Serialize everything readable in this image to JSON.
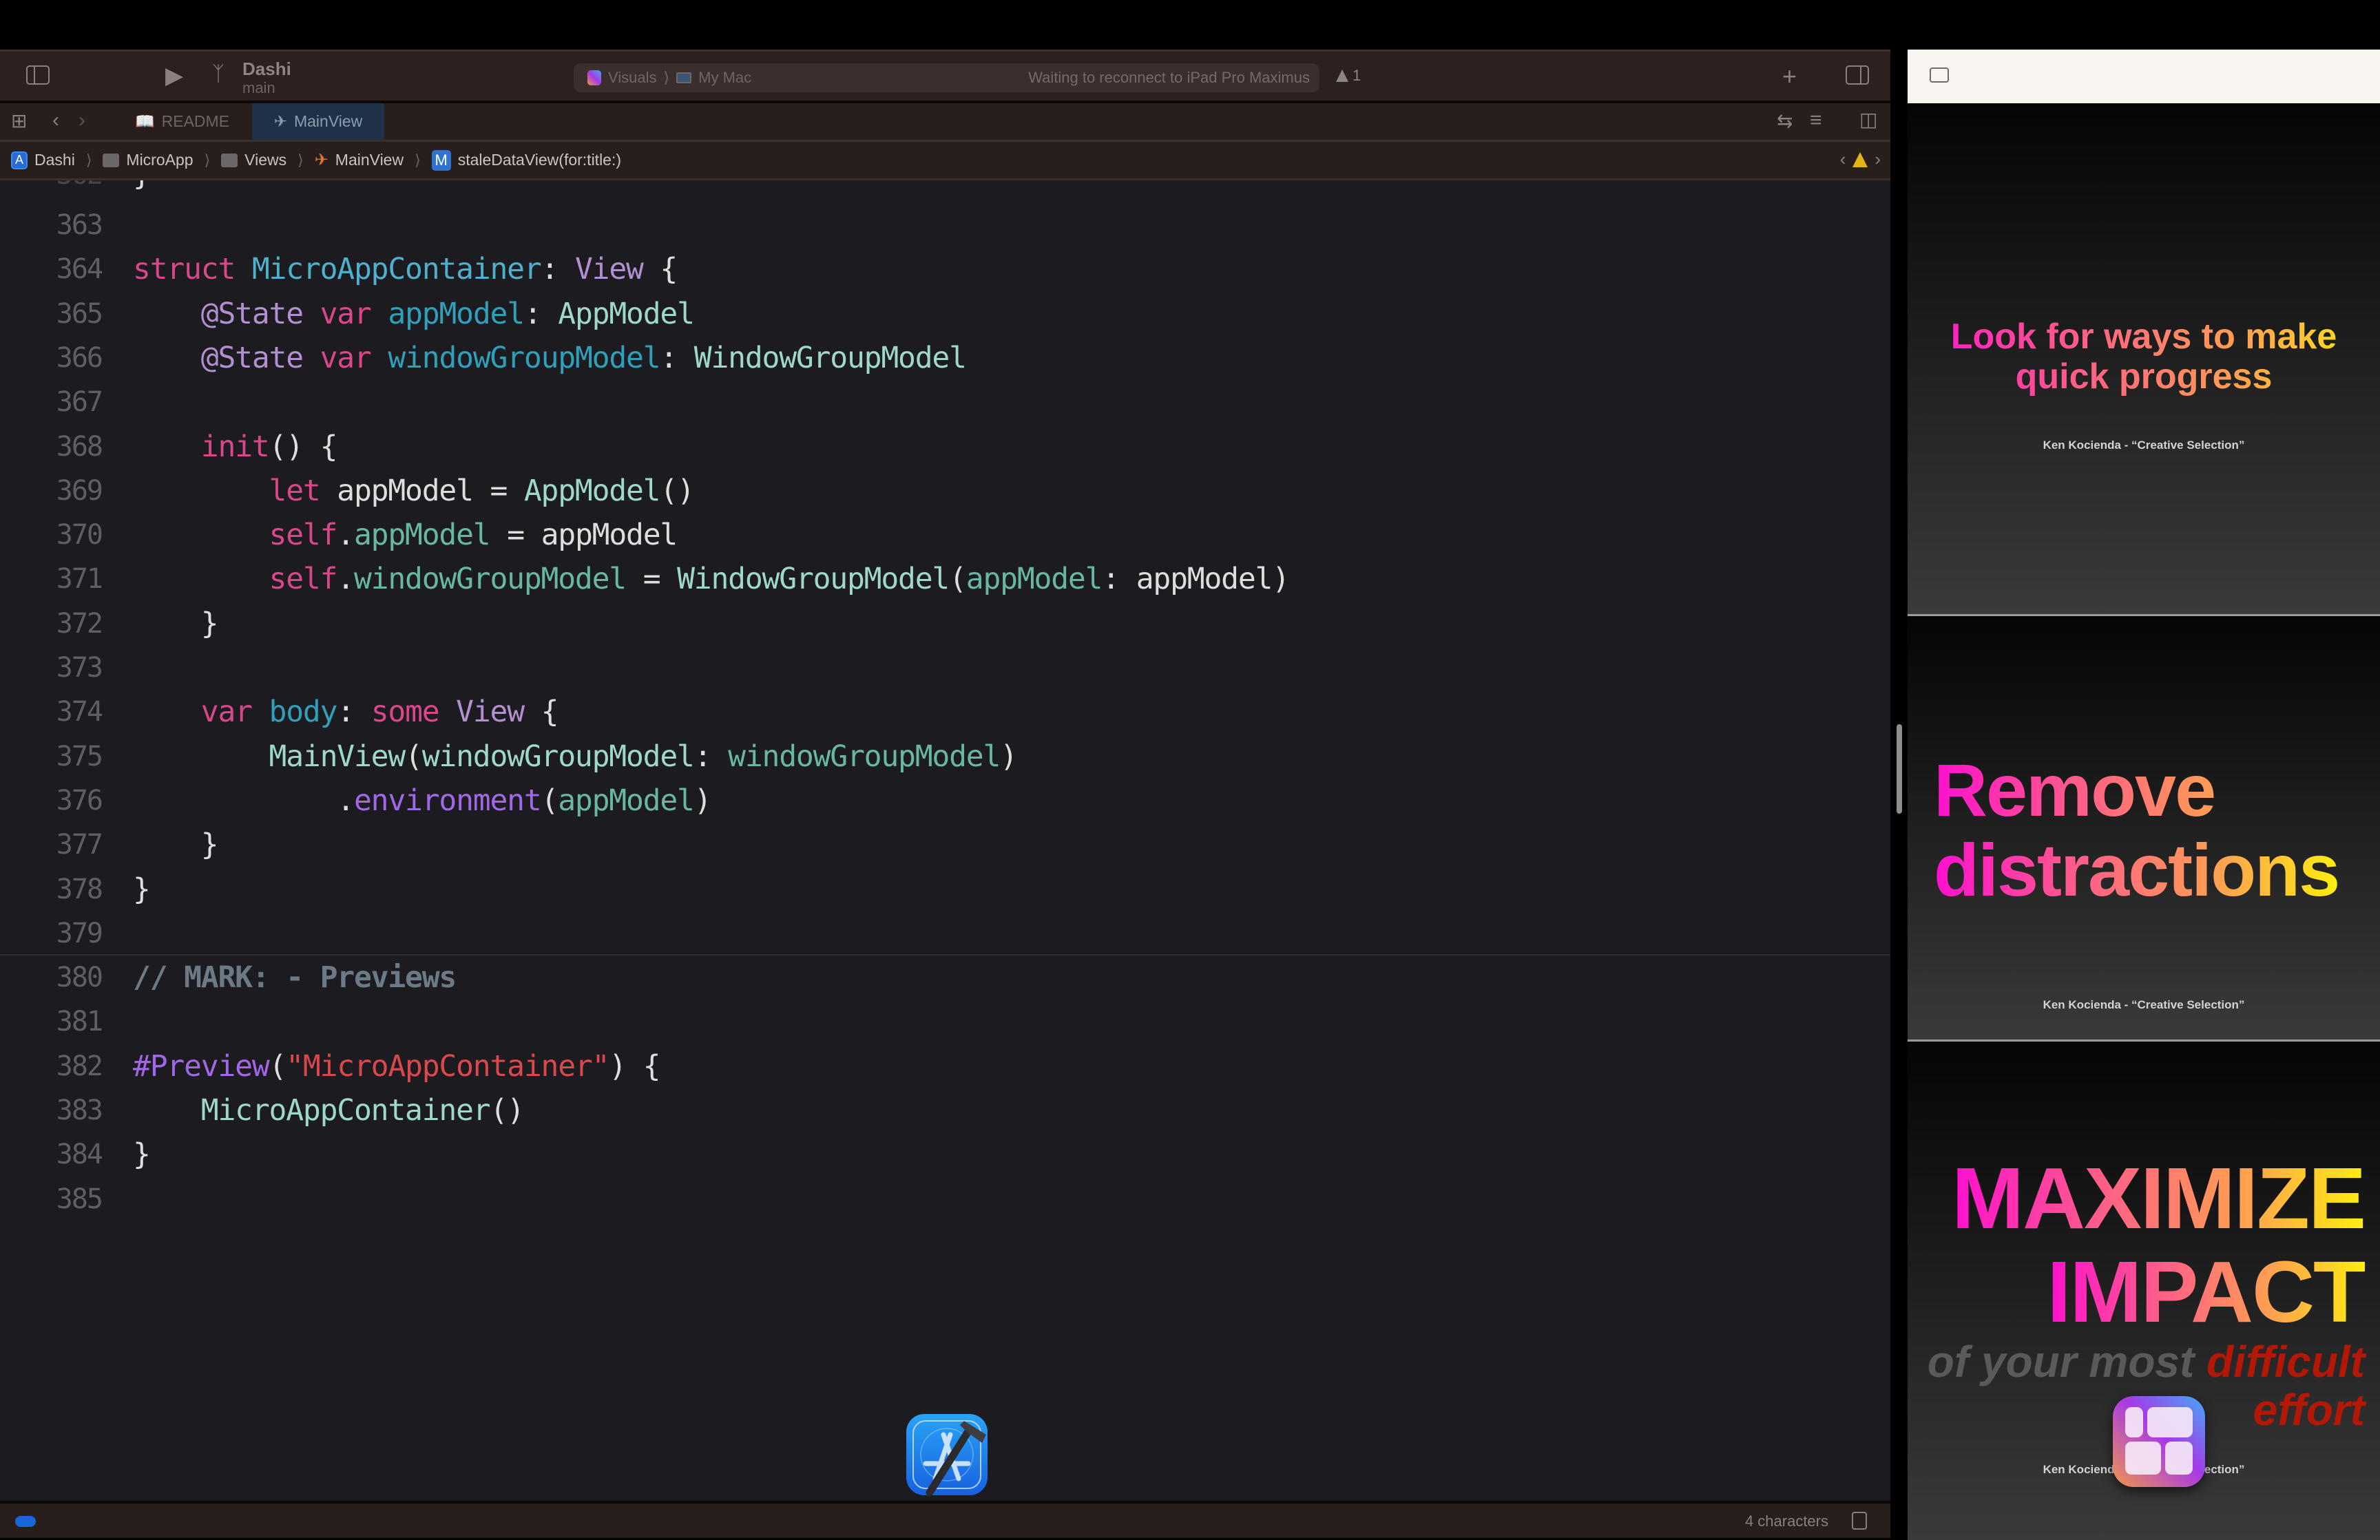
{
  "toolbar": {
    "scheme_name": "Dashi",
    "branch": "main",
    "destination_project": "Visuals",
    "destination_device": "My Mac",
    "status": "Waiting to reconnect to iPad Pro Maximus",
    "warning_count": "1",
    "icons": [
      "sidebar-toggle-icon",
      "run-icon",
      "branch-icon",
      "add-icon",
      "inspector-toggle-icon"
    ]
  },
  "tabs": [
    {
      "label": "README",
      "icon": "book-icon",
      "active": false
    },
    {
      "label": "MainView",
      "icon": "swift-icon",
      "active": true
    }
  ],
  "jumpbar": {
    "crumbs": [
      {
        "label": "Dashi",
        "icon": "project-icon"
      },
      {
        "label": "MicroApp",
        "icon": "folder-icon"
      },
      {
        "label": "Views",
        "icon": "folder-icon"
      },
      {
        "label": "MainView",
        "icon": "swift-icon"
      },
      {
        "label": "staleDataView(for:title:)",
        "icon": "method-icon",
        "icon_letter": "M"
      }
    ]
  },
  "editor": {
    "lines": [
      {
        "n": "363",
        "tokens": []
      },
      {
        "n": "364",
        "tokens": [
          [
            "k",
            "struct"
          ],
          [
            "pl",
            " "
          ],
          [
            "ty",
            "MicroAppContainer"
          ],
          [
            "pl",
            ": "
          ],
          [
            "att",
            "View"
          ],
          [
            "pl",
            " {"
          ]
        ]
      },
      {
        "n": "365",
        "tokens": [
          [
            "pl",
            "    "
          ],
          [
            "att",
            "@State"
          ],
          [
            "pl",
            " "
          ],
          [
            "k",
            "var"
          ],
          [
            "pl",
            " "
          ],
          [
            "pv",
            "appModel"
          ],
          [
            "pl",
            ": "
          ],
          [
            "tp",
            "AppModel"
          ]
        ]
      },
      {
        "n": "366",
        "tokens": [
          [
            "pl",
            "    "
          ],
          [
            "att",
            "@State"
          ],
          [
            "pl",
            " "
          ],
          [
            "k",
            "var"
          ],
          [
            "pl",
            " "
          ],
          [
            "pv",
            "windowGroupModel"
          ],
          [
            "pl",
            ": "
          ],
          [
            "tp",
            "WindowGroupModel"
          ]
        ]
      },
      {
        "n": "367",
        "tokens": []
      },
      {
        "n": "368",
        "tokens": [
          [
            "pl",
            "    "
          ],
          [
            "k",
            "init"
          ],
          [
            "pl",
            "() {"
          ]
        ]
      },
      {
        "n": "369",
        "tokens": [
          [
            "pl",
            "        "
          ],
          [
            "k",
            "let"
          ],
          [
            "pl",
            " appModel = "
          ],
          [
            "tp",
            "AppModel"
          ],
          [
            "pl",
            "()"
          ]
        ]
      },
      {
        "n": "370",
        "tokens": [
          [
            "pl",
            "        "
          ],
          [
            "k",
            "self"
          ],
          [
            "pl",
            "."
          ],
          [
            "fn",
            "appModel"
          ],
          [
            "pl",
            " = appModel"
          ]
        ]
      },
      {
        "n": "371",
        "tokens": [
          [
            "pl",
            "        "
          ],
          [
            "k",
            "self"
          ],
          [
            "pl",
            "."
          ],
          [
            "fn",
            "windowGroupModel"
          ],
          [
            "pl",
            " = "
          ],
          [
            "tp",
            "WindowGroupModel"
          ],
          [
            "pl",
            "("
          ],
          [
            "fn",
            "appModel"
          ],
          [
            "pl",
            ": appModel)"
          ]
        ]
      },
      {
        "n": "372",
        "tokens": [
          [
            "pl",
            "    }"
          ]
        ]
      },
      {
        "n": "373",
        "tokens": []
      },
      {
        "n": "374",
        "tokens": [
          [
            "pl",
            "    "
          ],
          [
            "k",
            "var"
          ],
          [
            "pl",
            " "
          ],
          [
            "pv",
            "body"
          ],
          [
            "pl",
            ": "
          ],
          [
            "k",
            "some"
          ],
          [
            "pl",
            " "
          ],
          [
            "att",
            "View"
          ],
          [
            "pl",
            " {"
          ]
        ]
      },
      {
        "n": "375",
        "tokens": [
          [
            "pl",
            "        "
          ],
          [
            "tp",
            "MainView"
          ],
          [
            "pl",
            "("
          ],
          [
            "tp",
            "windowGroupModel"
          ],
          [
            "pl",
            ": "
          ],
          [
            "fn",
            "windowGroupModel"
          ],
          [
            "pl",
            ")"
          ]
        ]
      },
      {
        "n": "376",
        "tokens": [
          [
            "pl",
            "            ."
          ],
          [
            "pr",
            "environment"
          ],
          [
            "pl",
            "("
          ],
          [
            "fn",
            "appModel"
          ],
          [
            "pl",
            ")"
          ]
        ]
      },
      {
        "n": "377",
        "tokens": [
          [
            "pl",
            "    }"
          ]
        ]
      },
      {
        "n": "378",
        "tokens": [
          [
            "pl",
            "}"
          ]
        ]
      },
      {
        "n": "379",
        "tokens": []
      },
      {
        "n": "380",
        "tokens": [
          [
            "cm",
            "// MARK: - Previews"
          ]
        ],
        "mark": true
      },
      {
        "n": "381",
        "tokens": []
      },
      {
        "n": "382",
        "tokens": [
          [
            "pr",
            "#Preview"
          ],
          [
            "pl",
            "("
          ],
          [
            "st",
            "\"MicroAppContainer\""
          ],
          [
            "pl",
            ") {"
          ]
        ]
      },
      {
        "n": "383",
        "tokens": [
          [
            "pl",
            "    "
          ],
          [
            "tp",
            "MicroAppContainer"
          ],
          [
            "pl",
            "()"
          ]
        ]
      },
      {
        "n": "384",
        "tokens": [
          [
            "pl",
            "}"
          ]
        ]
      },
      {
        "n": "385",
        "tokens": []
      }
    ]
  },
  "statusbar": {
    "selection": "4 characters"
  },
  "dock": {
    "app": "Xcode"
  },
  "panel": {
    "slides": [
      {
        "title_lines": [
          "Look for ways to make",
          "quick progress"
        ],
        "credit": "Ken Kocienda - “Creative Selection”"
      },
      {
        "title_lines": [
          "Remove",
          "distractions"
        ],
        "credit": "Ken Kocienda - “Creative Selection”"
      },
      {
        "title_lines": [
          "MAXIMIZE",
          "IMPACT"
        ],
        "subtitle_dim": "of your most ",
        "subtitle_red": "difficult",
        "subtitle_red_2": "effort",
        "credit": "Ken Kocienda - “Creative Selection”"
      }
    ]
  },
  "colors": {
    "keyword": "#d9468a",
    "type_decl": "#4eb0cc",
    "property_decl": "#2f9fba",
    "type_ref": "#9ed8c9",
    "attribute": "#b28fd0",
    "member": "#67b7a4",
    "macro": "#a167e6",
    "string": "#d9484d",
    "comment": "#6c7986",
    "active_tab": "#1f3148",
    "warning": "#e4b315"
  }
}
